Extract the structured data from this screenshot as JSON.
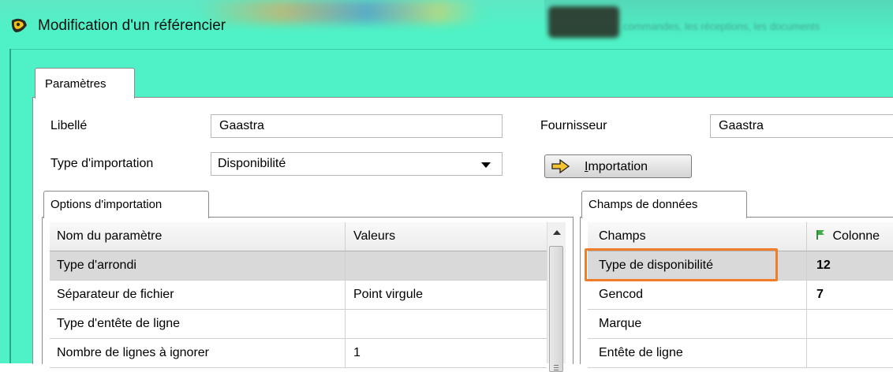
{
  "window": {
    "title": "Modification d'un référencier",
    "app_icon": "app-icon",
    "background_ghost_text": "commandes, les réceptions, les documents"
  },
  "tabs": [
    {
      "label": "Paramètres",
      "active": true
    }
  ],
  "form": {
    "libelle_label": "Libellé",
    "libelle_value": "Gaastra",
    "fournisseur_label": "Fournisseur",
    "fournisseur_value": "Gaastra",
    "type_import_label": "Type d'importation",
    "type_import_value": "Disponibilité",
    "import_button_label_underlined": "I",
    "import_button_label_rest": "mportation",
    "import_button_icon": "arrow-right-icon"
  },
  "options_panel": {
    "tab_label": "Options d'importation",
    "columns": [
      "Nom du paramètre",
      "Valeurs"
    ],
    "rows": [
      {
        "name": "Type d'arrondi",
        "value": "",
        "selected": true
      },
      {
        "name": "Séparateur de fichier",
        "value": "Point virgule",
        "selected": false
      },
      {
        "name": "Type d'entête de ligne",
        "value": "",
        "selected": false
      },
      {
        "name": "Nombre de lignes à ignorer",
        "value": "1",
        "selected": false
      }
    ]
  },
  "fields_panel": {
    "tab_label": "Champs de données",
    "columns": [
      "Champs",
      "Colonne"
    ],
    "column_icon": "sort-flag-icon",
    "rows": [
      {
        "name": "Type de disponibilité",
        "value": "12",
        "selected": true,
        "highlighted": true
      },
      {
        "name": "Gencod",
        "value": "7",
        "selected": false
      },
      {
        "name": "Marque",
        "value": "",
        "selected": false
      },
      {
        "name": "Entête de ligne",
        "value": "",
        "selected": false
      }
    ]
  },
  "colors": {
    "title_bar": "#4ff2c6",
    "highlight_box": "#ef7d2a",
    "selected_row": "#d9d9d9"
  }
}
